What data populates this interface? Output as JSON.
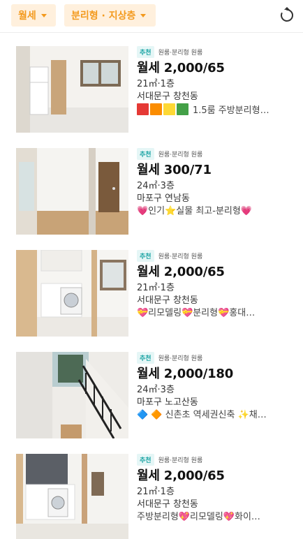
{
  "filters": {
    "type_label": "월세",
    "room_label": "분리형 · 지상층"
  },
  "listings": [
    {
      "badge": "추천",
      "subtype": "원룸·분리형 원룸",
      "price": "월세 2,000/65",
      "area_floor": "21㎡·1층",
      "location": "서대문구 창천동",
      "description": "1.5룸 주방분리형…",
      "color_blocks": [
        "#e53935",
        "#fb8c00",
        "#fdd835",
        "#43a047"
      ]
    },
    {
      "badge": "추천",
      "subtype": "원룸·분리형 원룸",
      "price": "월세 300/71",
      "area_floor": "24㎡·3층",
      "location": "마포구 연남동",
      "description": "💗인기⭐실물 최고-분리형💗"
    },
    {
      "badge": "추천",
      "subtype": "원룸·분리형 원룸",
      "price": "월세 2,000/65",
      "area_floor": "21㎡·1층",
      "location": "서대문구 창천동",
      "description": "💝리모델링💝분리형💝홍대…"
    },
    {
      "badge": "추천",
      "subtype": "원룸·분리형 원룸",
      "price": "월세 2,000/180",
      "area_floor": "24㎡·3층",
      "location": "마포구 노고산동",
      "description": "🔷 🔶 신촌초 역세권신축 ✨채…"
    },
    {
      "badge": "추천",
      "subtype": "원룸·분리형 원룸",
      "price": "월세 2,000/65",
      "area_floor": "21㎡·1층",
      "location": "서대문구 창천동",
      "description": "주방분리형💖리모델링💖화이…"
    }
  ],
  "colors": {
    "accent": "#f39a1e",
    "chip_bg": "#fff0dd",
    "badge_text": "#19a3a3",
    "badge_bg": "#e5f6f6"
  },
  "icons": {
    "type_dropdown": "chevron-down-icon",
    "room_dropdown": "chevron-down-icon",
    "refresh": "refresh-icon"
  }
}
